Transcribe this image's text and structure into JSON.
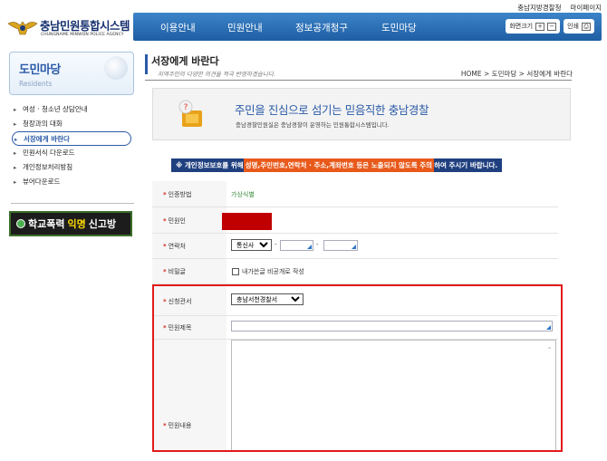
{
  "util": {
    "links": [
      "충남지방경찰청",
      "마이페이지"
    ]
  },
  "logo": {
    "title": "충남민원통합시스템",
    "subtitle": "CHUNGNAME MINWON POLICE AGENCY"
  },
  "gnb": {
    "menu": [
      "이용안내",
      "민원안내",
      "정보공개청구",
      "도민마당"
    ],
    "font_size_label": "화면크기",
    "plus": "+",
    "minus": "−",
    "print_label": "인쇄"
  },
  "sidebar": {
    "title": "도민마당",
    "subtitle": "Residents",
    "items": [
      {
        "label": "여성 · 청소년 상담안내",
        "active": false
      },
      {
        "label": "청장과의 대화",
        "active": false
      },
      {
        "label": "서장에게 바란다",
        "active": true
      },
      {
        "label": "민원서식 다운로드",
        "active": false
      },
      {
        "label": "개인정보처리방침",
        "active": false
      },
      {
        "label": "뷰어다운로드",
        "active": false
      }
    ],
    "banner": {
      "white1": "학교폭력",
      "yellow": "익명",
      "white2": "신고방"
    }
  },
  "content": {
    "title": "서장에게 바란다",
    "subtitle": "지역주민의 다양한 의견을 적극 반영하겠습니다.",
    "breadcrumb": "HOME > 도민마당 > 서장에게 바란다",
    "intro_big": "주민을 진심으로 섬기는 믿음직한 충남경찰",
    "intro_small": "충남경찰민원실은 충남경찰이 운영하는 민원통합시스템입니다.",
    "notice_pre": "※ 개인정보보호를 위해 ",
    "notice_hl": "성명,주민번호,연락처 · 주소,계좌번호 등은 노출되지 않도록 주의",
    "notice_post": "하여 주시기 바랍니다."
  },
  "form": {
    "required_mark": "*",
    "auth_label": "인증방법",
    "auth_value": "가상식별",
    "applicant_label": "민원인",
    "contact_label": "연락처",
    "carrier_value": "통신사",
    "dash": "-",
    "password_label": "비밀글",
    "password_checkbox_label": "내가쓴글 비공개로 작성",
    "agency_label": "신청관서",
    "agency_value": "충남서천경찰서",
    "subject_label": "민원제목",
    "body_label": "민원내용"
  },
  "colors": {
    "navy": "#1f3f7f",
    "accent_orange": "#e8591a",
    "frame_red": "#e21a1a",
    "gnb_blue": "#2a6db4"
  }
}
